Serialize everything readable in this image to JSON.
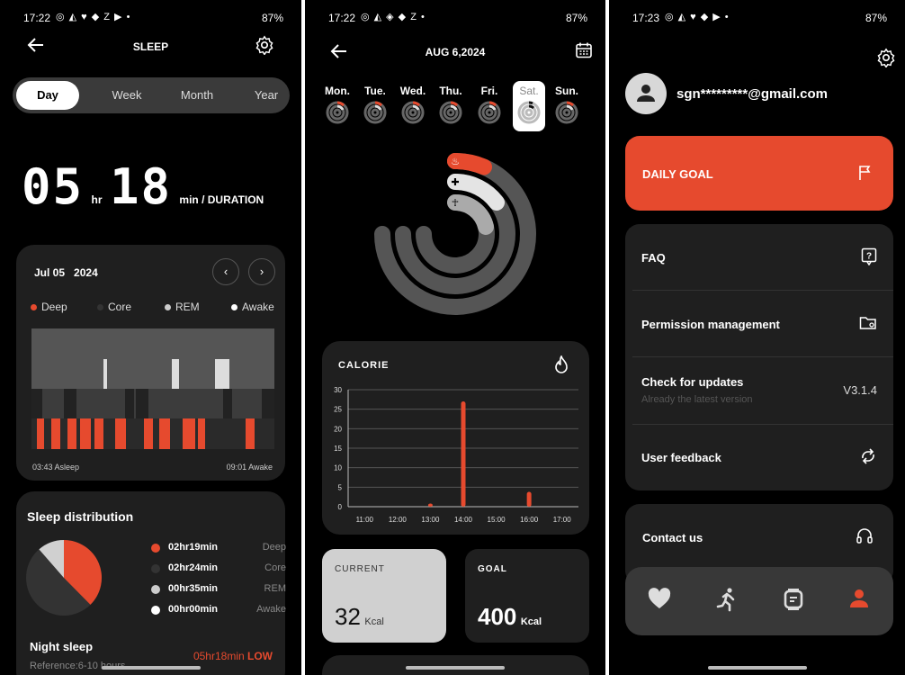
{
  "status": [
    {
      "time": "17:22",
      "battery": "87%"
    },
    {
      "time": "17:22",
      "battery": "87%"
    },
    {
      "time": "17:23",
      "battery": "87%"
    }
  ],
  "sleep": {
    "title": "SLEEP",
    "tabs": [
      "Day",
      "Week",
      "Month",
      "Year"
    ],
    "active_tab": "Day",
    "duration_hr": "05",
    "hr_unit": "hr",
    "duration_min": "18",
    "min_unit": "min / DURATION",
    "chart_date": "Jul 05",
    "chart_year": "2024",
    "legend": [
      {
        "label": "Deep",
        "color": "#e64a2e"
      },
      {
        "label": "Core",
        "color": "#333333"
      },
      {
        "label": "REM",
        "color": "#cccccc"
      },
      {
        "label": "Awake",
        "color": "#ffffff"
      }
    ],
    "asleep_label": "03:43 Asleep",
    "awake_label": "09:01 Awake",
    "dist_title": "Sleep distribution",
    "distribution": [
      {
        "value": "02hr19min",
        "label": "Deep",
        "color": "#e64a2e"
      },
      {
        "value": "02hr24min",
        "label": "Core",
        "color": "#333333"
      },
      {
        "value": "00hr35min",
        "label": "REM",
        "color": "#cccccc"
      },
      {
        "value": "00hr00min",
        "label": "Awake",
        "color": "#ffffff"
      }
    ],
    "night_title": "Night sleep",
    "night_value": "05hr18min",
    "night_status": "LOW",
    "reference": "Reference:6-10 hours"
  },
  "activity": {
    "date": "AUG 6,2024",
    "days": [
      "Mon.",
      "Tue.",
      "Wed.",
      "Thu.",
      "Fri.",
      "Sat.",
      "Sun."
    ],
    "selected_day": "Sat.",
    "calorie_title": "CALORIE",
    "current_label": "CURRENT",
    "current_value": "32",
    "current_unit": "Kcal",
    "goal_label": "GOAL",
    "goal_value": "400",
    "goal_unit": "Kcal",
    "chart_data": {
      "type": "bar",
      "x": [
        "11:00",
        "12:00",
        "13:00",
        "14:00",
        "15:00",
        "16:00",
        "17:00"
      ],
      "yticks": [
        0,
        5,
        10,
        15,
        20,
        25,
        30
      ],
      "ylim": [
        0,
        30
      ],
      "points": [
        {
          "t": 13.0,
          "v": 0.8
        },
        {
          "t": 14.0,
          "v": 27
        },
        {
          "t": 16.0,
          "v": 3.8
        }
      ],
      "bar_color": "#e64a2e",
      "grid": true
    }
  },
  "profile": {
    "email": "sgn*********@gmail.com",
    "daily_goal": "DAILY GOAL",
    "faq": "FAQ",
    "permission": "Permission management",
    "updates": "Check for updates",
    "updates_sub": "Already the latest version",
    "version": "V3.1.4",
    "feedback": "User feedback",
    "contact": "Contact us",
    "accent": "#e64a2e"
  }
}
